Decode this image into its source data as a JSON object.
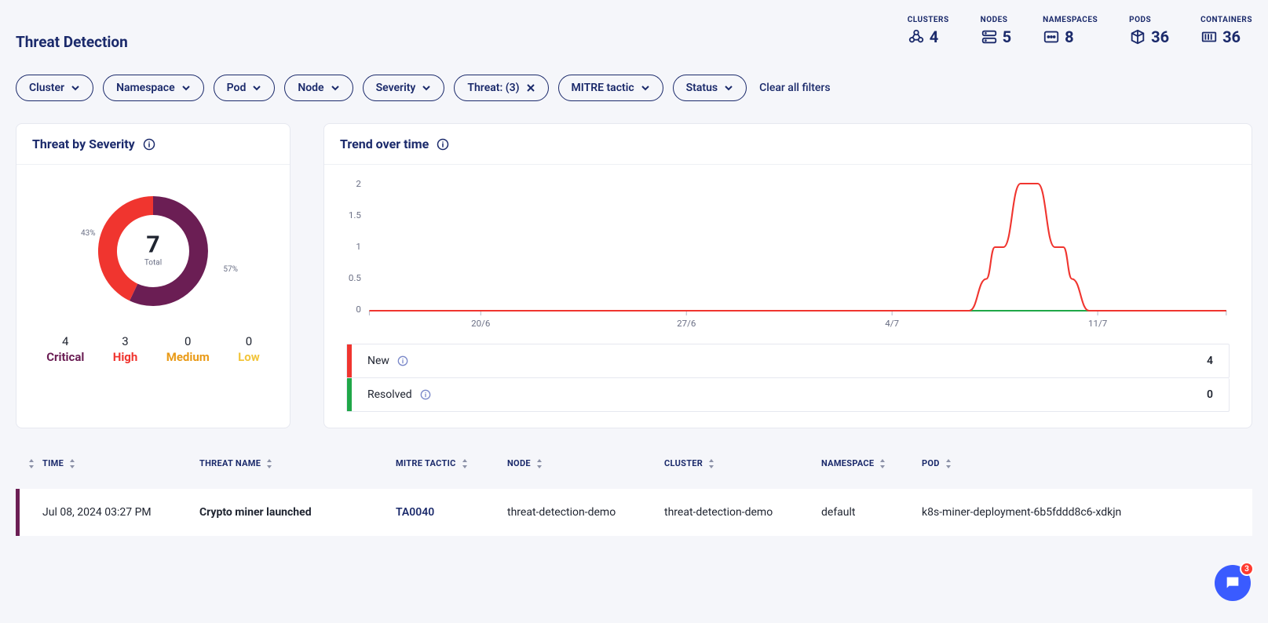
{
  "header": {
    "title": "Threat Detection",
    "stats": {
      "clusters": {
        "label": "CLUSTERS",
        "value": "4"
      },
      "nodes": {
        "label": "NODES",
        "value": "5"
      },
      "namespaces": {
        "label": "NAMESPACES",
        "value": "8"
      },
      "pods": {
        "label": "PODS",
        "value": "36"
      },
      "containers": {
        "label": "CONTAINERS",
        "value": "36"
      }
    }
  },
  "filters": {
    "cluster": "Cluster",
    "namespace": "Namespace",
    "pod": "Pod",
    "node": "Node",
    "severity": "Severity",
    "threat": "Threat: (3)",
    "mitre": "MITRE tactic",
    "status": "Status",
    "clear": "Clear all filters"
  },
  "severityCard": {
    "title": "Threat by Severity",
    "total": "7",
    "totalLabel": "Total",
    "pctA": "43%",
    "pctB": "57%",
    "breakdown": {
      "critical": {
        "value": "4",
        "label": "Critical"
      },
      "high": {
        "value": "3",
        "label": "High"
      },
      "medium": {
        "value": "0",
        "label": "Medium"
      },
      "low": {
        "value": "0",
        "label": "Low"
      }
    }
  },
  "trendCard": {
    "title": "Trend over time",
    "yticks": [
      "2",
      "1.5",
      "1",
      "0.5",
      "0"
    ],
    "xticks": [
      "20/6",
      "27/6",
      "4/7",
      "11/7"
    ],
    "legend": {
      "new": {
        "label": "New",
        "value": "4",
        "color": "#f0352f"
      },
      "resolved": {
        "label": "Resolved",
        "value": "0",
        "color": "#1fa748"
      }
    }
  },
  "chart_data": {
    "type": "line",
    "title": "Trend over time",
    "xlabel": "",
    "ylabel": "",
    "ylim": [
      0,
      2
    ],
    "x": [
      "20/6",
      "27/6",
      "4/7",
      "11/7"
    ],
    "x_positions": [
      0.13,
      0.37,
      0.61,
      0.85
    ],
    "series": [
      {
        "name": "New",
        "color": "#f0352f",
        "points_xy": [
          [
            0.0,
            0.0
          ],
          [
            0.7,
            0.0
          ],
          [
            0.72,
            0.5
          ],
          [
            0.73,
            1.0
          ],
          [
            0.74,
            1.0
          ],
          [
            0.76,
            2.0
          ],
          [
            0.78,
            2.0
          ],
          [
            0.8,
            1.0
          ],
          [
            0.81,
            1.0
          ],
          [
            0.82,
            0.5
          ],
          [
            0.84,
            0.0
          ],
          [
            1.0,
            0.0
          ]
        ]
      },
      {
        "name": "Resolved",
        "color": "#1fa748",
        "points_xy": [
          [
            0.0,
            0.0
          ],
          [
            1.0,
            0.0
          ]
        ]
      }
    ]
  },
  "table": {
    "columns": {
      "time": "TIME",
      "threat": "THREAT NAME",
      "mitre": "MITRE TACTIC",
      "node": "NODE",
      "cluster": "CLUSTER",
      "namespace": "NAMESPACE",
      "pod": "POD"
    },
    "rows": [
      {
        "time": "Jul 08, 2024 03:27 PM",
        "threat": "Crypto miner launched",
        "mitre": "TA0040",
        "node": "threat-detection-demo",
        "cluster": "threat-detection-demo",
        "namespace": "default",
        "pod": "k8s-miner-deployment-6b5fddd8c6-xdkjn"
      }
    ]
  },
  "chat": {
    "badge": "3"
  }
}
